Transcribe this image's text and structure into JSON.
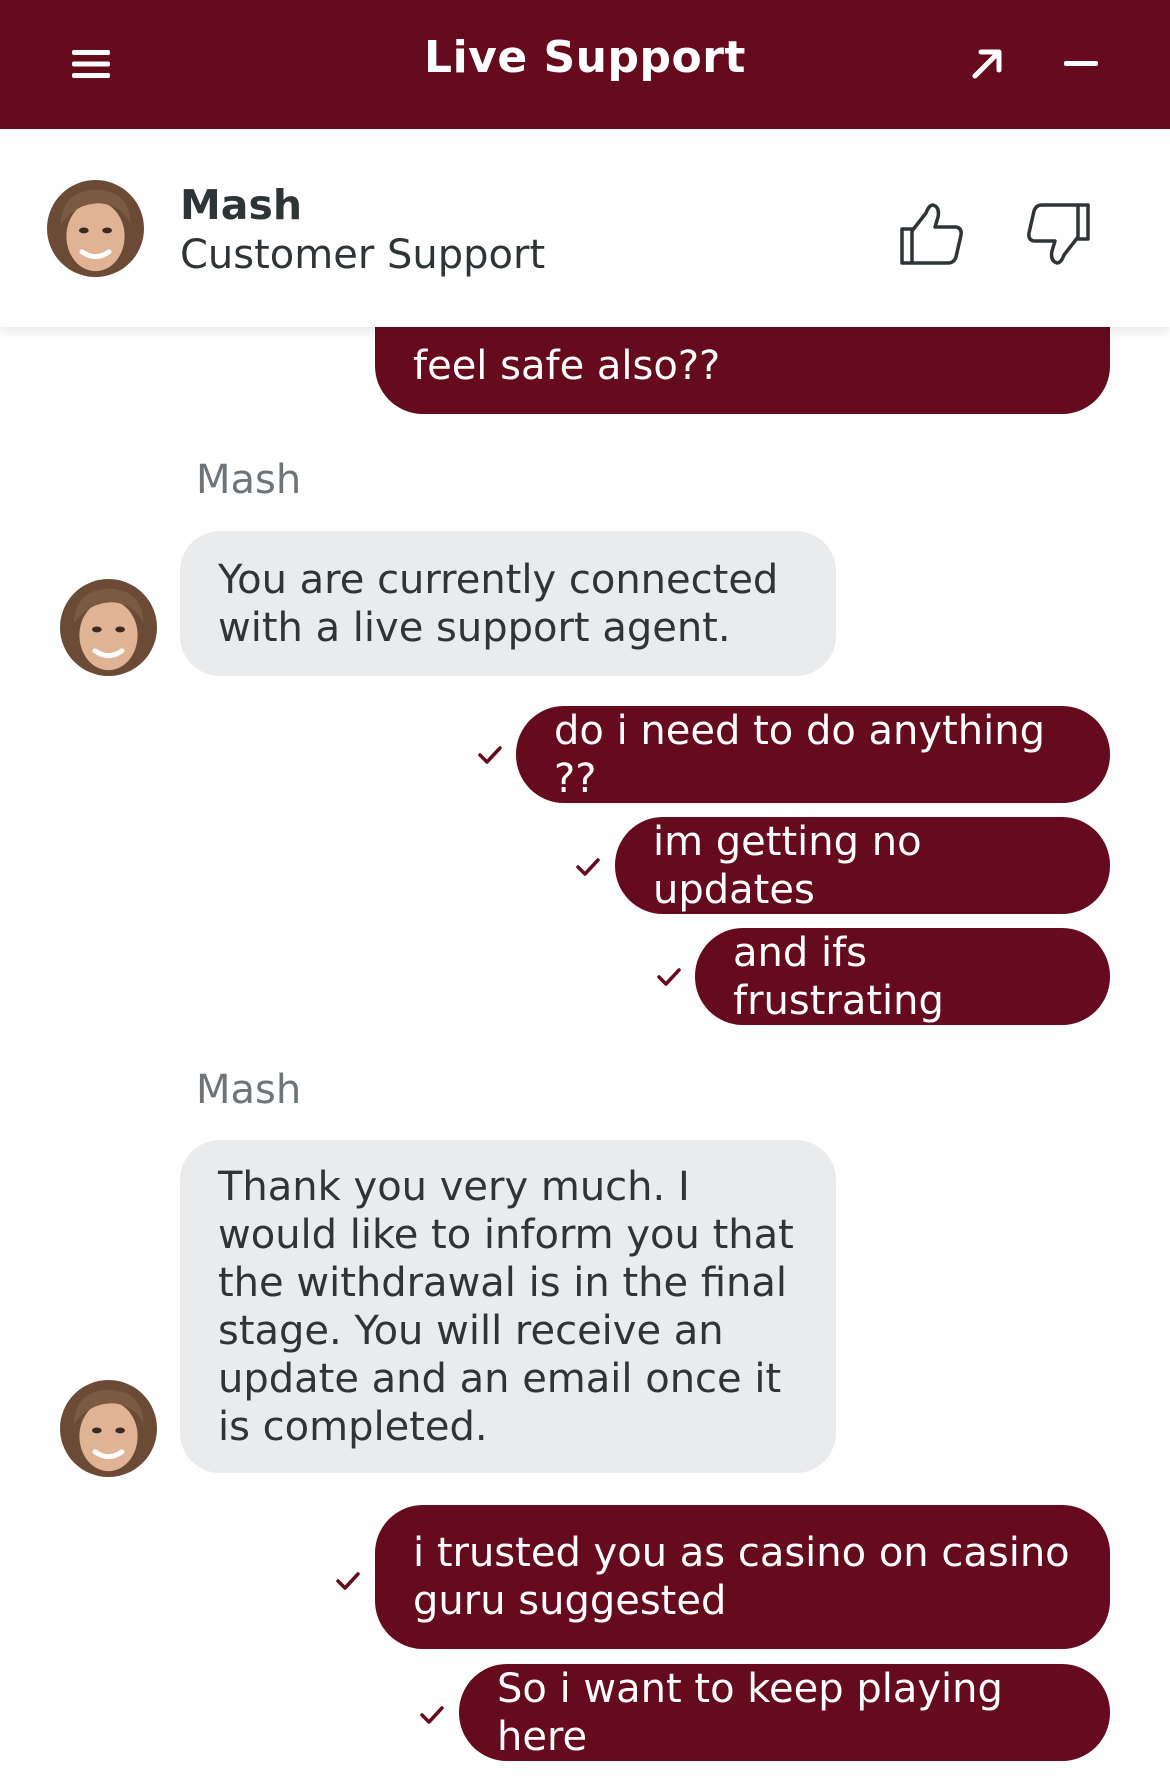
{
  "header": {
    "title": "Live Support",
    "bg_color": "#650b1d",
    "icons": [
      "menu-icon",
      "expand-arrow-icon",
      "minimize-icon"
    ]
  },
  "agent": {
    "name": "Mash",
    "role": "Customer Support",
    "rating_icons": [
      "thumbs-up-icon",
      "thumbs-down-icon"
    ]
  },
  "messages": [
    {
      "from": "user",
      "text": "feel safe also??"
    },
    {
      "from": "agent",
      "sender": "Mash",
      "text": "You are currently connected with a live support agent."
    },
    {
      "from": "user",
      "text": "do i need to do anything ??",
      "status": "sent"
    },
    {
      "from": "user",
      "text": "im getting no updates",
      "status": "sent"
    },
    {
      "from": "user",
      "text": "and ifs frustrating",
      "status": "sent"
    },
    {
      "from": "agent",
      "sender": "Mash",
      "text": "Thank you very much. I would like to inform you that the withdrawal is in the final stage. You will receive an update and an email once it is completed."
    },
    {
      "from": "user",
      "text": "i trusted you as casino on casino guru suggested",
      "status": "sent"
    },
    {
      "from": "user",
      "text": "So i want to keep playing here",
      "status": "sent"
    }
  ],
  "colors": {
    "user_bubble": "#650b1d",
    "agent_bubble": "#e9ebed",
    "text_dark": "#2f3437",
    "sender_label": "#6e7478"
  }
}
